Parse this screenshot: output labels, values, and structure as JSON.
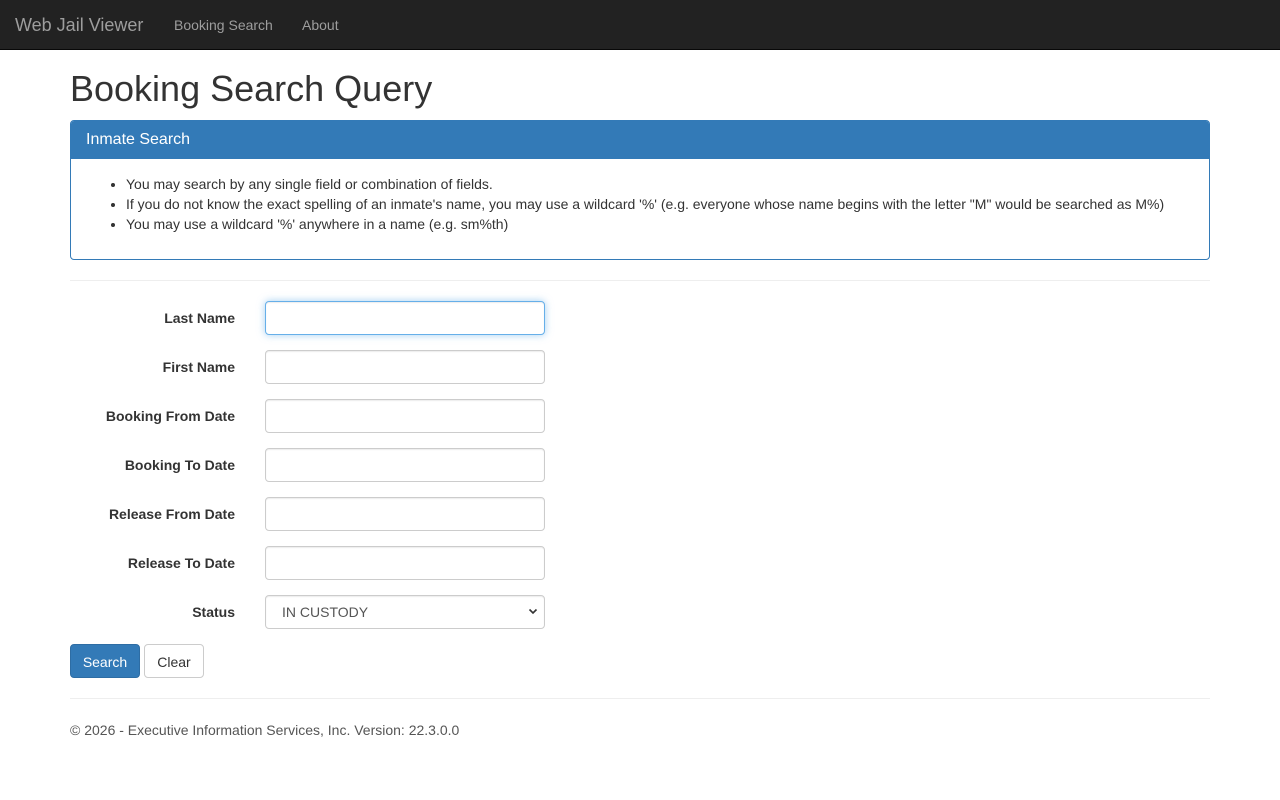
{
  "navbar": {
    "brand": "Web Jail Viewer",
    "links": [
      "Booking Search",
      "About"
    ]
  },
  "page": {
    "title": "Booking Search Query"
  },
  "panel": {
    "heading": "Inmate Search",
    "tips": [
      "You may search by any single field or combination of fields.",
      "If you do not know the exact spelling of an inmate's name, you may use a wildcard '%' (e.g. everyone whose name begins with the letter \"M\" would be searched as M%)",
      "You may use a wildcard '%' anywhere in a name (e.g. sm%th)"
    ]
  },
  "form": {
    "last_name": {
      "label": "Last Name",
      "value": ""
    },
    "first_name": {
      "label": "First Name",
      "value": ""
    },
    "booking_from": {
      "label": "Booking From Date",
      "value": ""
    },
    "booking_to": {
      "label": "Booking To Date",
      "value": ""
    },
    "release_from": {
      "label": "Release From Date",
      "value": ""
    },
    "release_to": {
      "label": "Release To Date",
      "value": ""
    },
    "status": {
      "label": "Status",
      "selected": "IN CUSTODY"
    }
  },
  "buttons": {
    "search": "Search",
    "clear": "Clear"
  },
  "footer": {
    "text": "© 2026 - Executive Information Services, Inc. Version: 22.3.0.0"
  },
  "colors": {
    "navbar": "#222222",
    "primary": "#337ab7",
    "focus": "#66afe9"
  }
}
